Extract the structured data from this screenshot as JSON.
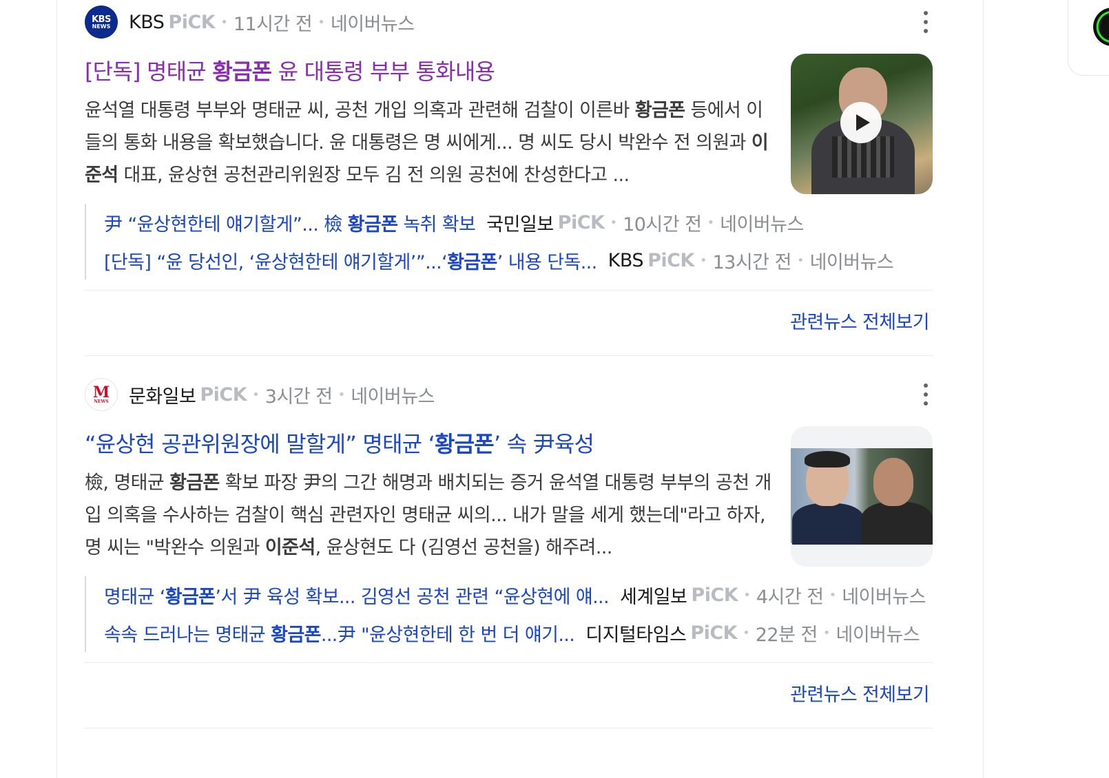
{
  "articles": [
    {
      "logo_text_1": "KBS",
      "logo_text_2": "NEWS",
      "press": "KBS",
      "pick": "PiCK",
      "time": "11시간 전",
      "source": "네이버뉴스",
      "title": {
        "pre": "[단독] 명태균 ",
        "bold": "황금폰",
        "post": " 윤 대통령 부부 통화내용"
      },
      "desc": {
        "p1": "윤석열 대통령 부부와 명태균 씨, 공천 개입 의혹과 관련해 검찰이 이른바 ",
        "b1": "황금폰",
        "p2": " 등에서 이들의 통화 내용을 확보했습니다. 윤 대통령은 명 씨에게... 명 씨도 당시 박완수 전 의원과 ",
        "b2": "이준석",
        "p3": " 대표, 윤상현 공천관리위원장 모두 김 전 의원 공천에 찬성한다고 ..."
      },
      "related": [
        {
          "pre": "尹 “윤상현한테 얘기할게”... 檢 ",
          "bold": "황금폰",
          "post": " 녹취 확보",
          "press": "국민일보",
          "pick": "PiCK",
          "time": "10시간 전",
          "source": "네이버뉴스"
        },
        {
          "pre": "[단독] “윤 당선인, ‘윤상현한테 얘기할게’”...‘",
          "bold": "황금폰",
          "post": "’ 내용 단독...",
          "press": "KBS",
          "pick": "PiCK",
          "time": "13시간 전",
          "source": "네이버뉴스"
        }
      ],
      "more": "관련뉴스 전체보기"
    },
    {
      "logo_text_1": "M",
      "logo_text_2": "NEWS",
      "press": "문화일보",
      "pick": "PiCK",
      "time": "3시간 전",
      "source": "네이버뉴스",
      "title": {
        "pre": "“윤상현 공관위원장에 말할게” 명태균 ‘",
        "bold": "황금폰",
        "post": "’ 속 尹육성"
      },
      "desc": {
        "p1": "檢, 명태균 ",
        "b1": "황금폰",
        "p2": " 확보 파장 尹의 그간 해명과 배치되는 증거 윤석열 대통령 부부의 공천 개입 의혹을 수사하는 검찰이 핵심 관련자인 명태균 씨의... 내가 말을 세게 했는데\"라고 하자, 명 씨는 \"박완수 의원과 ",
        "b2": "이준석",
        "p3": ", 윤상현도 다 (김영선 공천을) 해주려..."
      },
      "related": [
        {
          "pre": "명태균 ‘",
          "bold": "황금폰",
          "post": "’서 尹 육성 확보... 김영선 공천 관련 “윤상현에 얘...",
          "press": "세계일보",
          "pick": "PiCK",
          "time": "4시간 전",
          "source": "네이버뉴스"
        },
        {
          "pre": "속속 드러나는 명태균 ",
          "bold": "황금폰",
          "post": "...尹 \"윤상현한테 한 번 더 얘기...",
          "press": "디지털타임스",
          "pick": "PiCK",
          "time": "22분 전",
          "source": "네이버뉴스"
        }
      ],
      "more": "관련뉴스 전체보기"
    }
  ],
  "colors": {
    "visited_title": "#8a2cb1",
    "link": "#1a47c8",
    "pick_gray": "#b8bcc2",
    "meta_gray": "#8a8d92"
  },
  "icons": {
    "menu": "kebab-icon",
    "play": "play-icon"
  }
}
